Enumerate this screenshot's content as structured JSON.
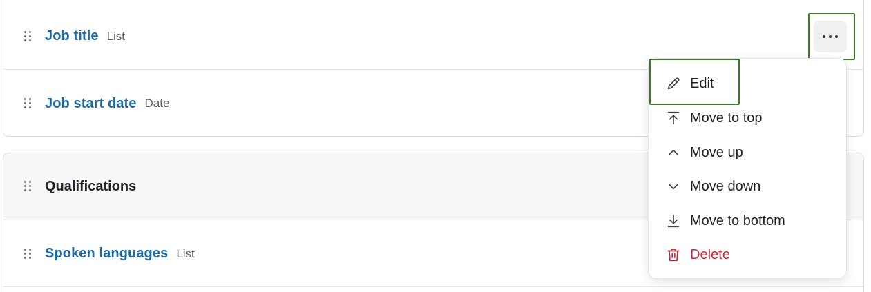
{
  "sections": [
    {
      "fields": [
        {
          "name": "Job title",
          "type": "List"
        },
        {
          "name": "Job start date",
          "type": "Date"
        }
      ]
    },
    {
      "title": "Qualifications",
      "fields": [
        {
          "name": "Spoken languages",
          "type": "List"
        }
      ]
    }
  ],
  "more_button": {
    "icon": "ellipsis-horizontal-icon"
  },
  "menu": {
    "items": [
      {
        "label": "Edit",
        "icon": "pencil-icon"
      },
      {
        "label": "Move to top",
        "icon": "arrow-to-top-icon"
      },
      {
        "label": "Move up",
        "icon": "chevron-up-icon"
      },
      {
        "label": "Move down",
        "icon": "chevron-down-icon"
      },
      {
        "label": "Move to bottom",
        "icon": "arrow-to-bottom-icon"
      },
      {
        "label": "Delete",
        "icon": "trash-icon"
      }
    ]
  },
  "colors": {
    "link": "#1d6aa3",
    "delete": "#c8283a",
    "highlight": "#3d7a26"
  }
}
